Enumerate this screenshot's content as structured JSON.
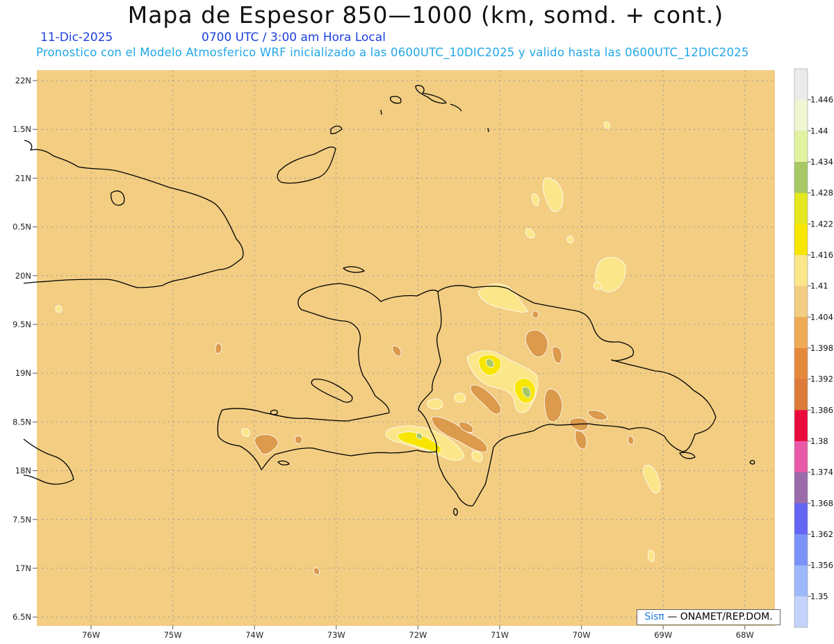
{
  "header": {
    "title": "Mapa de Espesor 850—1000 (km, somd. + cont.)",
    "date": "11-Dic-2025",
    "time": "0700 UTC / 3:00 am Hora Local",
    "subtitle": "Pronostico con el Modelo Atmosferico WRF inicializado a las 0600UTC_10DIC2025 y valido hasta las  0600UTC_12DIC2025"
  },
  "map": {
    "background_color": "#f2cd82",
    "lat_labels": [
      "22N",
      "1.5N",
      "21N",
      "0.5N",
      "20N",
      "9.5N",
      "19N",
      "8.5N",
      "18N",
      "7.5N",
      "17N",
      "6.5N"
    ],
    "lon_labels": [
      "76W",
      "75W",
      "74W",
      "73W",
      "72W",
      "71W",
      "70W",
      "69W",
      "68W"
    ],
    "grid": "dotted"
  },
  "colorbar": {
    "labels": [
      "1.446",
      "1.44",
      "1.434",
      "1.428",
      "1.422",
      "1.416",
      "1.41",
      "1.404",
      "1.398",
      "1.392",
      "1.386",
      "1.38",
      "1.374",
      "1.368",
      "1.362",
      "1.356",
      "1.35"
    ],
    "colors": [
      "#ebebeb",
      "#f0f5d2",
      "#e1f2a0",
      "#a6c966",
      "#e3e81f",
      "#f8e600",
      "#fbe68a",
      "#f2cd82",
      "#efaa57",
      "#e5893e",
      "#dc7a39",
      "#ea0b3c",
      "#e85aa8",
      "#9b6aab",
      "#6565f5",
      "#7a92f7",
      "#9cb8fb",
      "#c3d3fb"
    ]
  },
  "credit": {
    "brand": "Sisπ",
    "org": "— ONAMET/REP.DOM."
  }
}
